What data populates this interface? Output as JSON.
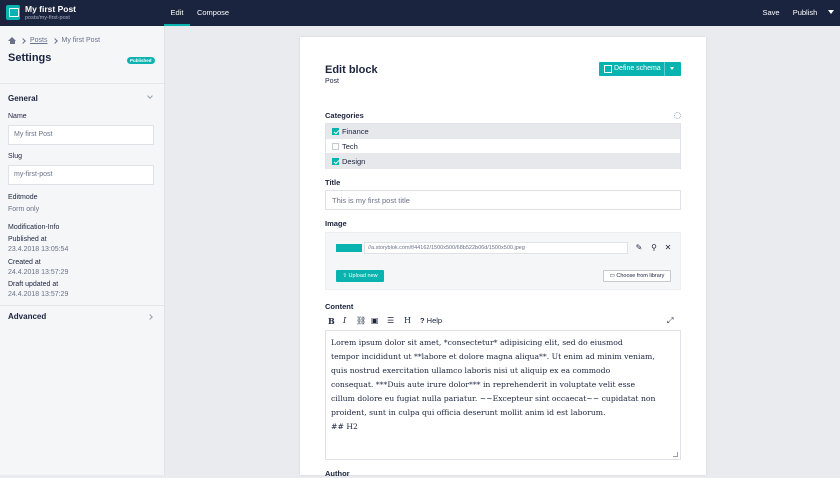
{
  "topbar": {
    "title": "My first Post",
    "slug": "posts/my-first-post",
    "tabs": [
      "Edit",
      "Compose"
    ],
    "save_label": "Save",
    "publish_label": "Publish"
  },
  "sidebar": {
    "breadcrumbs": [
      "Posts",
      "My first Post"
    ],
    "title": "Settings",
    "status_badge": "Published",
    "general": {
      "label": "General",
      "name_label": "Name",
      "name_value": "My first Post",
      "slug_label": "Slug",
      "slug_value": "my-first-post",
      "editmode_label": "Editmode",
      "editmode_value": "Form only",
      "modinfo_label": "Modification-Info",
      "published_label": "Published at",
      "published_value": "23.4.2018 13:05:54",
      "created_label": "Created at",
      "created_value": "24.4.2018 13:57:29",
      "draft_label": "Draft updated at",
      "draft_value": "24.4.2018 13:57:29"
    },
    "advanced_label": "Advanced"
  },
  "editor": {
    "title": "Edit block",
    "subtitle": "Post",
    "schema_button": "Define schema",
    "categories_label": "Categories",
    "categories": [
      {
        "label": "Finance",
        "checked": true
      },
      {
        "label": "Tech",
        "checked": false
      },
      {
        "label": "Design",
        "checked": true
      }
    ],
    "title_label": "Title",
    "title_value": "This is my first post title",
    "image_label": "Image",
    "image_url": "//a.storyblok.com/f/44162/1500x500/68b522b06d/1500x500.jpeg",
    "upload_button": "Upload new",
    "library_button": "Choose from library",
    "content_label": "Content",
    "help_label": "Help",
    "content_lines": [
      "Lorem ipsum dolor sit amet, *consectetur* adipisicing elit, sed do eiusmod",
      "tempor incididunt ut **labore et dolore magna aliqua**. Ut enim ad minim veniam,",
      "quis nostrud exercitation ullamco laboris nisi ut aliquip ex ea commodo",
      "consequat. ***Duis aute irure dolor*** in reprehenderit in voluptate velit esse",
      "cillum dolore eu fugiat nulla pariatur. ~~Excepteur sint occaecat~~ cupidatat non",
      "proident, sunt in culpa qui officia deserunt mollit anim id est laborum.",
      "",
      "## H2"
    ],
    "author_label": "Author"
  },
  "colors": {
    "accent": "#09b3af",
    "topbar": "#1b243f"
  }
}
